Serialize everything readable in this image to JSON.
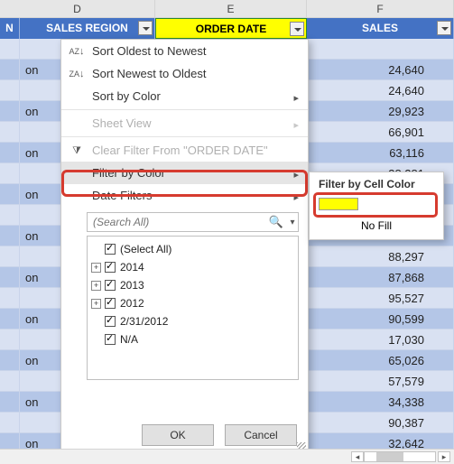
{
  "columns": {
    "D": "D",
    "E": "E",
    "F": "F"
  },
  "headers": {
    "sliverN": "N",
    "salesRegion": "SALES REGION",
    "orderDate": "ORDER DATE",
    "sales": "SALES"
  },
  "rows": [
    {
      "region": "",
      "sales": ""
    },
    {
      "region": "on",
      "sales": "24,640"
    },
    {
      "region": "",
      "sales": "24,640"
    },
    {
      "region": "on",
      "sales": "29,923"
    },
    {
      "region": "",
      "sales": "66,901"
    },
    {
      "region": "on",
      "sales": "63,116"
    },
    {
      "region": "",
      "sales": "38,281"
    },
    {
      "region": "on",
      "sales": ""
    },
    {
      "region": "",
      "sales": ""
    },
    {
      "region": "on",
      "sales": ""
    },
    {
      "region": "",
      "sales": "88,297"
    },
    {
      "region": "on",
      "sales": "87,868"
    },
    {
      "region": "",
      "sales": "95,527"
    },
    {
      "region": "on",
      "sales": "90,599"
    },
    {
      "region": "",
      "sales": "17,030"
    },
    {
      "region": "on",
      "sales": "65,026"
    },
    {
      "region": "",
      "sales": "57,579"
    },
    {
      "region": "on",
      "sales": "34,338"
    },
    {
      "region": "",
      "sales": "90,387"
    },
    {
      "region": "on",
      "sales": "32,642"
    }
  ],
  "menu": {
    "sortOldest": "Sort Oldest to Newest",
    "sortNewest": "Sort Newest to Oldest",
    "sortByColor": "Sort by Color",
    "sheetView": "Sheet View",
    "clearFilter": "Clear Filter From \"ORDER DATE\"",
    "filterByColor": "Filter by Color",
    "dateFilters": "Date Filters",
    "searchPlaceholder": "(Search All)",
    "tree": {
      "selectAll": "(Select All)",
      "n2014": "2014",
      "n2013": "2013",
      "n2012": "2012",
      "nDate": "2/31/2012",
      "nNA": "N/A"
    },
    "ok": "OK",
    "cancel": "Cancel"
  },
  "flyout": {
    "title": "Filter by Cell Color",
    "swatchColor": "#FFFF00",
    "noFill": "No Fill"
  },
  "icons": {
    "sortAsc": "A↓",
    "sortDesc": "Z↓",
    "chevron": "▸",
    "funnel": "⧩",
    "mag": "🔍",
    "dd": "▾",
    "arrL": "◂",
    "arrR": "▸"
  },
  "chart_data": null
}
